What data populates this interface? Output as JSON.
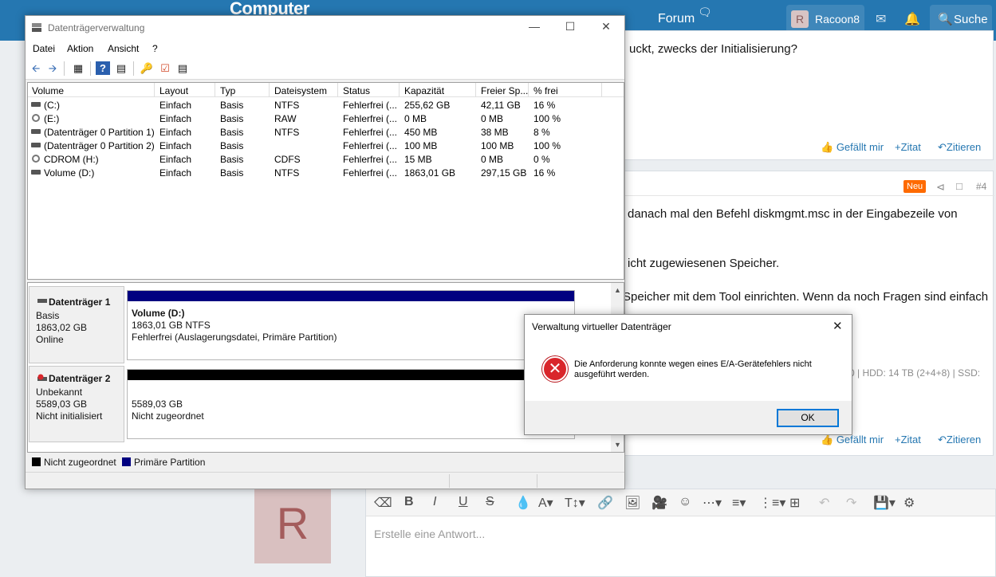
{
  "forum": {
    "logo": "Computer",
    "nav_forum": "Forum",
    "user_initial": "R",
    "user_name": "Racoon8",
    "search_label": "Suche",
    "post1": {
      "text_line": "uckt, zwecks der Initialisierung?",
      "actions": [
        "Gefällt mir",
        "+Zitat",
        "Zitieren"
      ]
    },
    "post2": {
      "badge": "Neu",
      "number": "#4",
      "lines": [
        "danach mal den Befehl diskmgmt.msc in der Eingabezeile von",
        "icht zugewiesenen Speicher.",
        "Speicher mit dem Tool einrichten. Wenn da noch Fragen sind einfach"
      ],
      "signature": "0 | HDD: 14 TB (2+4+8) | SSD:",
      "actions": [
        "Gefällt mir",
        "+Zitat",
        "Zitieren"
      ]
    },
    "reply_avatar": "R",
    "editor_placeholder": "Erstelle eine Antwort..."
  },
  "diskmgmt": {
    "title": "Datenträgerverwaltung",
    "menu": [
      "Datei",
      "Aktion",
      "Ansicht",
      "?"
    ],
    "columns": [
      "Volume",
      "Layout",
      "Typ",
      "Dateisystem",
      "Status",
      "Kapazität",
      "Freier Sp...",
      "% frei"
    ],
    "volumes": [
      {
        "volume": "(C:)",
        "layout": "Einfach",
        "typ": "Basis",
        "fs": "NTFS",
        "status": "Fehlerfrei (...",
        "cap": "255,62 GB",
        "free": "42,11 GB",
        "pct": "16 %",
        "icon": "drive"
      },
      {
        "volume": "(E:)",
        "layout": "Einfach",
        "typ": "Basis",
        "fs": "RAW",
        "status": "Fehlerfrei (...",
        "cap": "0 MB",
        "free": "0 MB",
        "pct": "100 %",
        "icon": "cd"
      },
      {
        "volume": "(Datenträger 0 Partition 1)",
        "layout": "Einfach",
        "typ": "Basis",
        "fs": "NTFS",
        "status": "Fehlerfrei (...",
        "cap": "450 MB",
        "free": "38 MB",
        "pct": "8 %",
        "icon": "drive"
      },
      {
        "volume": "(Datenträger 0 Partition 2)",
        "layout": "Einfach",
        "typ": "Basis",
        "fs": "",
        "status": "Fehlerfrei (...",
        "cap": "100 MB",
        "free": "100 MB",
        "pct": "100 %",
        "icon": "drive"
      },
      {
        "volume": "CDROM (H:)",
        "layout": "Einfach",
        "typ": "Basis",
        "fs": "CDFS",
        "status": "Fehlerfrei (...",
        "cap": "15 MB",
        "free": "0 MB",
        "pct": "0 %",
        "icon": "cd"
      },
      {
        "volume": "Volume (D:)",
        "layout": "Einfach",
        "typ": "Basis",
        "fs": "NTFS",
        "status": "Fehlerfrei (...",
        "cap": "1863,01 GB",
        "free": "297,15 GB",
        "pct": "16 %",
        "icon": "drive"
      }
    ],
    "disk1": {
      "name": "Datenträger 1",
      "type": "Basis",
      "size": "1863,02 GB",
      "state": "Online",
      "partition_name": "Volume  (D:)",
      "partition_size": "1863,01 GB NTFS",
      "partition_status": "Fehlerfrei (Auslagerungsdatei, Primäre Partition)",
      "bar_color": "#000080"
    },
    "disk2": {
      "name": "Datenträger 2",
      "type": "Unbekannt",
      "size": "5589,03 GB",
      "state": "Nicht initialisiert",
      "partition_size": "5589,03 GB",
      "partition_status": "Nicht zugeordnet",
      "bar_color": "#000000"
    },
    "legend": [
      {
        "label": "Nicht zugeordnet",
        "color": "#000000"
      },
      {
        "label": "Primäre Partition",
        "color": "#000080"
      }
    ]
  },
  "dialog": {
    "title": "Verwaltung virtueller Datenträger",
    "message": "Die Anforderung konnte wegen eines E/A-Gerätefehlers nicht ausgeführt werden.",
    "ok_label": "OK",
    "icon": "error-icon"
  }
}
